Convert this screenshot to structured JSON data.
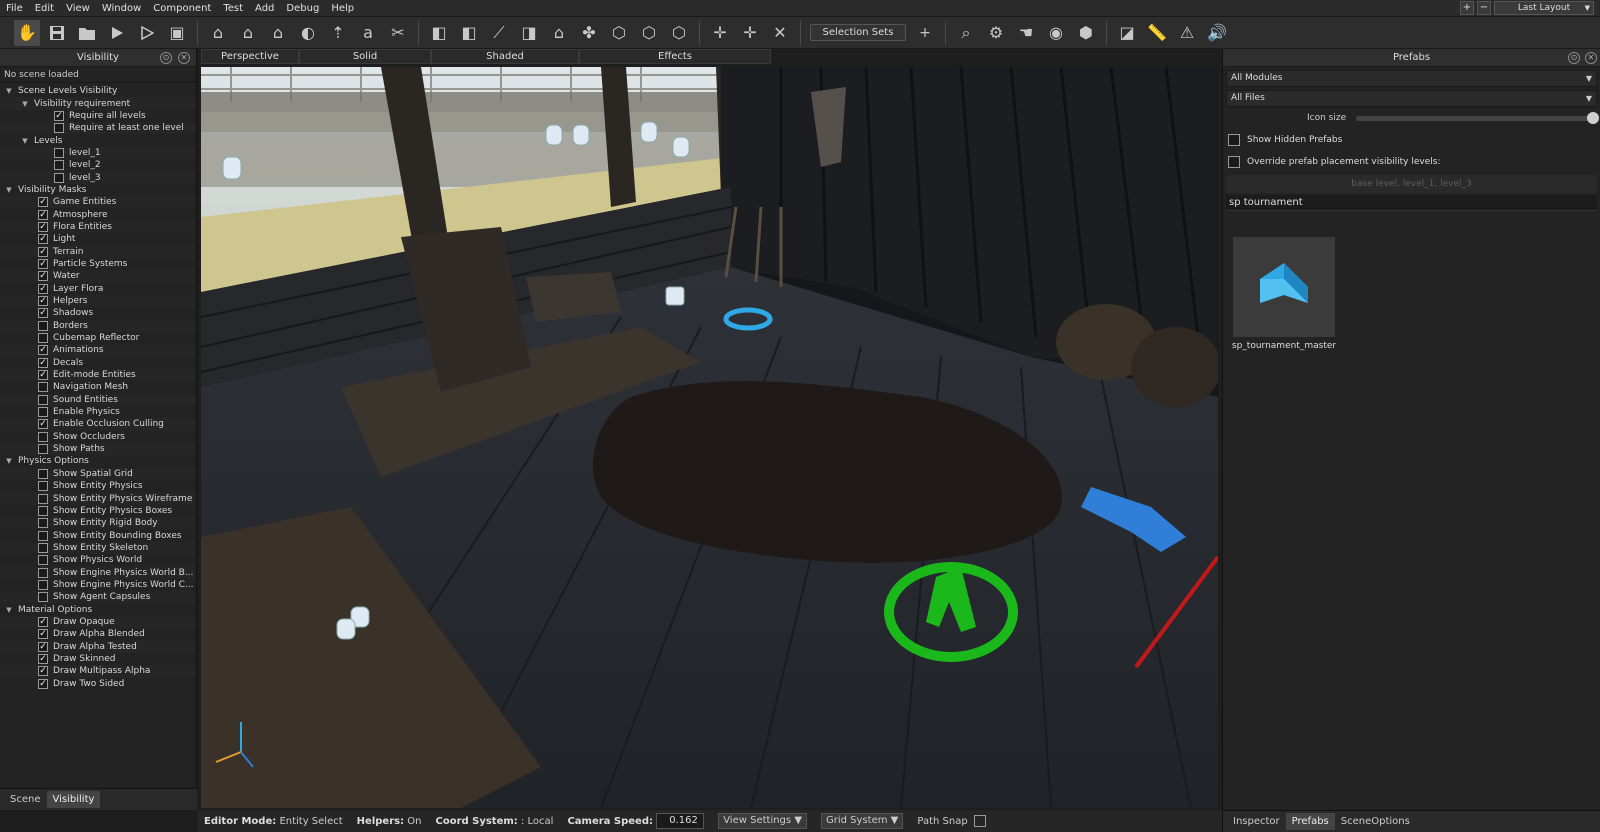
{
  "menu": {
    "items": [
      "File",
      "Edit",
      "View",
      "Window",
      "Component",
      "Test",
      "Add",
      "Debug",
      "Help"
    ],
    "layout_label": "Last Layout",
    "plus": "+",
    "minus": "−"
  },
  "toolbar": {
    "selection_sets": "Selection Sets",
    "add": "+"
  },
  "visibility": {
    "title": "Visibility",
    "status": "No scene loaded",
    "rows": [
      {
        "label": "Scene Levels Visibility",
        "depth": 0,
        "type": "group"
      },
      {
        "label": "Visibility requirement",
        "depth": 1,
        "type": "group"
      },
      {
        "label": "Require all levels",
        "depth": 2,
        "type": "check",
        "checked": true
      },
      {
        "label": "Require at least one level",
        "depth": 2,
        "type": "check",
        "checked": false
      },
      {
        "label": "Levels",
        "depth": 1,
        "type": "group"
      },
      {
        "label": "level_1",
        "depth": 2,
        "type": "check",
        "checked": false
      },
      {
        "label": "level_2",
        "depth": 2,
        "type": "check",
        "checked": false
      },
      {
        "label": "level_3",
        "depth": 2,
        "type": "check",
        "checked": false
      },
      {
        "label": "Visibility Masks",
        "depth": 0,
        "type": "group"
      },
      {
        "label": "Game Entities",
        "depth": 1,
        "type": "check",
        "checked": true
      },
      {
        "label": "Atmosphere",
        "depth": 1,
        "type": "check",
        "checked": true
      },
      {
        "label": "Flora Entities",
        "depth": 1,
        "type": "check",
        "checked": true
      },
      {
        "label": "Light",
        "depth": 1,
        "type": "check",
        "checked": true
      },
      {
        "label": "Terrain",
        "depth": 1,
        "type": "check",
        "checked": true
      },
      {
        "label": "Particle Systems",
        "depth": 1,
        "type": "check",
        "checked": true
      },
      {
        "label": "Water",
        "depth": 1,
        "type": "check",
        "checked": true
      },
      {
        "label": "Layer Flora",
        "depth": 1,
        "type": "check",
        "checked": true
      },
      {
        "label": "Helpers",
        "depth": 1,
        "type": "check",
        "checked": true
      },
      {
        "label": "Shadows",
        "depth": 1,
        "type": "check",
        "checked": true
      },
      {
        "label": "Borders",
        "depth": 1,
        "type": "check",
        "checked": false
      },
      {
        "label": "Cubemap Reflector",
        "depth": 1,
        "type": "check",
        "checked": false
      },
      {
        "label": "Animations",
        "depth": 1,
        "type": "check",
        "checked": true
      },
      {
        "label": "Decals",
        "depth": 1,
        "type": "check",
        "checked": true
      },
      {
        "label": "Edit-mode Entities",
        "depth": 1,
        "type": "check",
        "checked": true
      },
      {
        "label": "Navigation Mesh",
        "depth": 1,
        "type": "check",
        "checked": false
      },
      {
        "label": "Sound Entities",
        "depth": 1,
        "type": "check",
        "checked": false
      },
      {
        "label": "Enable Physics",
        "depth": 1,
        "type": "check",
        "checked": false
      },
      {
        "label": "Enable Occlusion Culling",
        "depth": 1,
        "type": "check",
        "checked": true
      },
      {
        "label": "Show Occluders",
        "depth": 1,
        "type": "check",
        "checked": false
      },
      {
        "label": "Show Paths",
        "depth": 1,
        "type": "check",
        "checked": false
      },
      {
        "label": "Physics Options",
        "depth": 0,
        "type": "group"
      },
      {
        "label": "Show Spatial Grid",
        "depth": 1,
        "type": "check",
        "checked": false
      },
      {
        "label": "Show Entity Physics",
        "depth": 1,
        "type": "check",
        "checked": false
      },
      {
        "label": "Show Entity Physics Wireframe",
        "depth": 1,
        "type": "check",
        "checked": false
      },
      {
        "label": "Show Entity Physics Boxes",
        "depth": 1,
        "type": "check",
        "checked": false
      },
      {
        "label": "Show Entity Rigid Body",
        "depth": 1,
        "type": "check",
        "checked": false
      },
      {
        "label": "Show Entity Bounding Boxes",
        "depth": 1,
        "type": "check",
        "checked": false
      },
      {
        "label": "Show Entity Skeleton",
        "depth": 1,
        "type": "check",
        "checked": false
      },
      {
        "label": "Show Physics World",
        "depth": 1,
        "type": "check",
        "checked": false
      },
      {
        "label": "Show Engine Physics World B...",
        "depth": 1,
        "type": "check",
        "checked": false
      },
      {
        "label": "Show Engine Physics World C...",
        "depth": 1,
        "type": "check",
        "checked": false
      },
      {
        "label": "Show Agent Capsules",
        "depth": 1,
        "type": "check",
        "checked": false
      },
      {
        "label": "Material Options",
        "depth": 0,
        "type": "group"
      },
      {
        "label": "Draw Opaque",
        "depth": 1,
        "type": "check",
        "checked": true
      },
      {
        "label": "Draw Alpha Blended",
        "depth": 1,
        "type": "check",
        "checked": true
      },
      {
        "label": "Draw Alpha Tested",
        "depth": 1,
        "type": "check",
        "checked": true
      },
      {
        "label": "Draw Skinned",
        "depth": 1,
        "type": "check",
        "checked": true
      },
      {
        "label": "Draw Multipass Alpha",
        "depth": 1,
        "type": "check",
        "checked": true
      },
      {
        "label": "Draw Two Sided",
        "depth": 1,
        "type": "check",
        "checked": true
      }
    ],
    "tabs": [
      {
        "label": "Scene",
        "active": false
      },
      {
        "label": "Visibility",
        "active": true
      }
    ]
  },
  "viewport": {
    "tabs": [
      "Perspective",
      "Solid",
      "Shaded",
      "Effects"
    ]
  },
  "statusbar": {
    "editor_mode_label": "Editor Mode:",
    "editor_mode_value": "Entity Select",
    "helpers_label": "Helpers:",
    "helpers_value": "On",
    "coord_label": "Coord System:",
    "coord_value": ": Local",
    "camera_speed_label": "Camera Speed:",
    "camera_speed_value": "0.162",
    "view_settings": "View Settings",
    "grid_system": "Grid System",
    "path_snap": "Path Snap"
  },
  "prefabs": {
    "title": "Prefabs",
    "modules": "All Modules",
    "files": "All Files",
    "icon_size_label": "Icon size",
    "icon_size": 1.0,
    "show_hidden": "Show Hidden Prefabs",
    "override": "Override prefab placement visibility levels:",
    "levels_text": "base level, level_1, level_3",
    "search": "sp tournament",
    "items": [
      {
        "name": "sp_tournament_master"
      }
    ],
    "tabs": [
      {
        "label": "Inspector",
        "active": false
      },
      {
        "label": "Prefabs",
        "active": true
      },
      {
        "label": "SceneOptions",
        "active": false
      }
    ]
  },
  "colors": {
    "accent_blue": "#2fa8e6",
    "gizmo_green": "#1bb81b"
  }
}
